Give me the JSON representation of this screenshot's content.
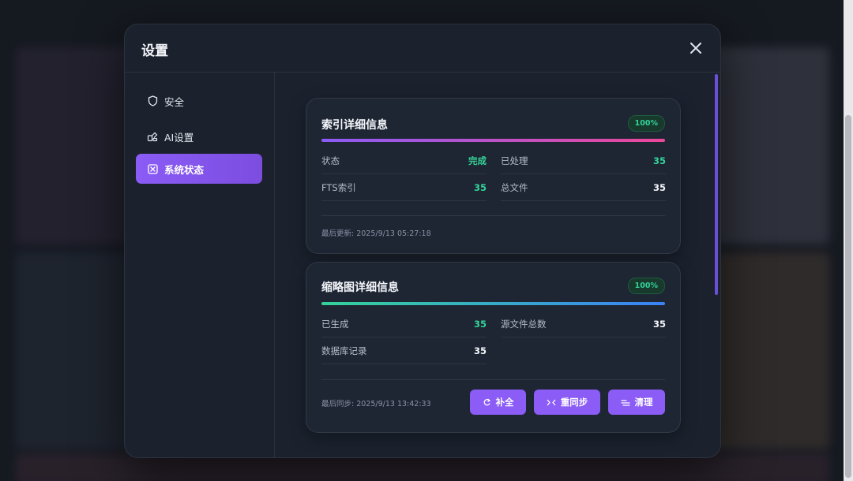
{
  "modal": {
    "title": "设置"
  },
  "sidebar": {
    "items": [
      {
        "label": "安全",
        "icon": "shield-icon"
      },
      {
        "label": "AI设置",
        "icon": "ai-settings-icon"
      },
      {
        "label": "系统状态",
        "icon": "system-status-icon",
        "active": true
      }
    ]
  },
  "index_card": {
    "title": "索引详细信息",
    "badge": "100%",
    "progress": 1.0,
    "stats": [
      {
        "label": "状态",
        "value": "完成"
      },
      {
        "label": "已处理",
        "value": "35"
      },
      {
        "label": "FTS索引",
        "value": "35"
      },
      {
        "label": "总文件",
        "value": "35"
      }
    ],
    "footnote": "最后更新: 2025/9/13 05:27:18"
  },
  "thumb_card": {
    "title": "缩略图详细信息",
    "badge": "100%",
    "progress": 1.0,
    "stats": [
      {
        "label": "已生成",
        "value": "35"
      },
      {
        "label": "源文件总数",
        "value": "35"
      },
      {
        "label": "数据库记录",
        "value": "35"
      }
    ],
    "footnote": "最后同步: 2025/9/13 13:42:33",
    "buttons": [
      {
        "label": "补全",
        "icon": "refresh-icon"
      },
      {
        "label": "重同步",
        "icon": "resync-icon"
      },
      {
        "label": "清理",
        "icon": "broom-icon"
      }
    ]
  },
  "colors": {
    "accent": "#8b5cf6",
    "success": "#34d399",
    "modal_bg": "#1b222e",
    "card_bg": "#1e2634"
  }
}
